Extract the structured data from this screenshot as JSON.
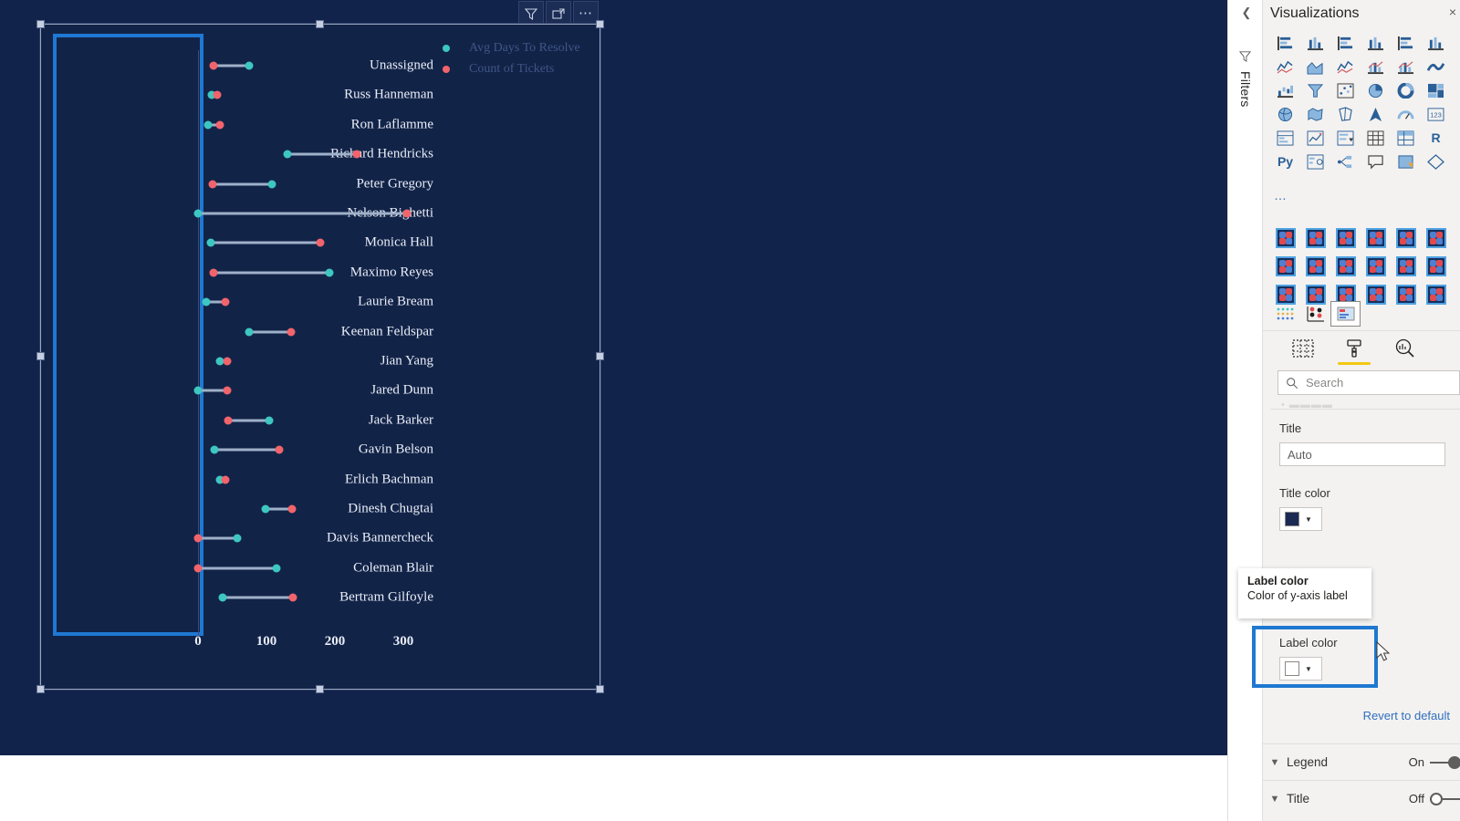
{
  "canvas": {
    "background_color": "#12234b",
    "visual_header": {
      "filter_icon": "filter-icon",
      "focus_icon": "focus-mode-icon",
      "more_icon": "more-options-icon"
    }
  },
  "chart_data": {
    "type": "bar",
    "subtype": "dumbbell",
    "title": "",
    "xlabel": "",
    "ylabel": "",
    "xlim": [
      0,
      340
    ],
    "xticks": [
      0,
      100,
      200,
      300
    ],
    "xtick_labels": [
      "0",
      "100",
      "200",
      "300"
    ],
    "grid": false,
    "legend_position": "top-right",
    "legend": [
      {
        "name": "Avg Days To Resolve",
        "color": "#3ec7c2"
      },
      {
        "name": "Count of Tickets",
        "color": "#f2646b"
      }
    ],
    "categories": [
      "Unassigned",
      "Russ Hanneman",
      "Ron Laflamme",
      "Richard Hendricks",
      "Peter Gregory",
      "Nelson Bighetti",
      "Monica Hall",
      "Maximo Reyes",
      "Laurie Bream",
      "Keenan Feldspar",
      "Jian Yang",
      "Jared Dunn",
      "Jack Barker",
      "Gavin Belson",
      "Erlich Bachman",
      "Dinesh Chugtai",
      "Davis Bannercheck",
      "Coleman Blair",
      "Bertram Gilfoyle"
    ],
    "series": [
      {
        "name": "Avg Days To Resolve",
        "color": "#3ec7c2",
        "values": [
          75,
          20,
          15,
          130,
          108,
          0,
          18,
          192,
          12,
          74,
          32,
          0,
          104,
          24,
          32,
          98,
          57,
          115,
          36
        ]
      },
      {
        "name": "Count of Tickets",
        "color": "#f2646b",
        "values": [
          22,
          28,
          32,
          232,
          21,
          305,
          178,
          22,
          40,
          136,
          43,
          42,
          44,
          118,
          40,
          137,
          0,
          0,
          138
        ]
      }
    ]
  },
  "right_pane": {
    "filters_rail": {
      "collapse_icon": "chevron-left-icon",
      "filter_icon": "filter-icon",
      "label": "Filters"
    },
    "title": "Visualizations",
    "close_label": "×",
    "gallery_icons": [
      "stacked-bar-chart-icon",
      "stacked-column-chart-icon",
      "clustered-bar-chart-icon",
      "clustered-column-chart-icon",
      "100-stacked-bar-chart-icon",
      "100-stacked-column-chart-icon",
      "line-chart-icon",
      "area-chart-icon",
      "stacked-area-chart-icon",
      "line-stacked-column-chart-icon",
      "line-clustered-column-chart-icon",
      "ribbon-chart-icon",
      "waterfall-chart-icon",
      "funnel-chart-icon",
      "scatter-chart-icon",
      "pie-chart-icon",
      "donut-chart-icon",
      "treemap-icon",
      "map-icon",
      "filled-map-icon",
      "shape-map-icon",
      "arcgis-map-icon",
      "gauge-icon",
      "card-icon",
      "multi-row-card-icon",
      "kpi-icon",
      "slicer-icon",
      "table-icon",
      "matrix-icon",
      "r-script-visual-icon",
      "python-visual-icon",
      "key-influencers-icon",
      "decomposition-tree-icon",
      "qa-visual-icon",
      "smart-narrative-icon",
      "paginated-report-icon"
    ],
    "more_visuals_label": "…",
    "custom_visuals_count": 18,
    "custom_row2_icons": [
      "matrix-dot-icon",
      "cluster-visual-icon",
      "selected-visual-icon"
    ],
    "format_tabs": [
      {
        "name": "fields-tab",
        "icon": "fields-icon",
        "active": false
      },
      {
        "name": "format-tab",
        "icon": "paint-roller-icon",
        "active": true
      },
      {
        "name": "analytics-tab",
        "icon": "analytics-magnifier-icon",
        "active": false
      }
    ],
    "search": {
      "placeholder": "Search",
      "value": "Search",
      "icon": "search-icon"
    },
    "properties": {
      "title_label": "Title",
      "title_value": "Auto",
      "title_color_label": "Title color",
      "title_color_value": "#1b2a52",
      "label_color_label": "Label color",
      "label_color_value": "#ffffff"
    },
    "tooltip": {
      "title": "Label color",
      "description": "Color of y-axis label"
    },
    "revert_label": "Revert to default",
    "sections": [
      {
        "name": "Legend",
        "state": "On",
        "toggle": "on"
      },
      {
        "name": "Title",
        "state": "Off",
        "toggle": "off"
      }
    ],
    "highlight_color": "#1f78d1",
    "cursor_icon": "mouse-pointer-icon"
  }
}
